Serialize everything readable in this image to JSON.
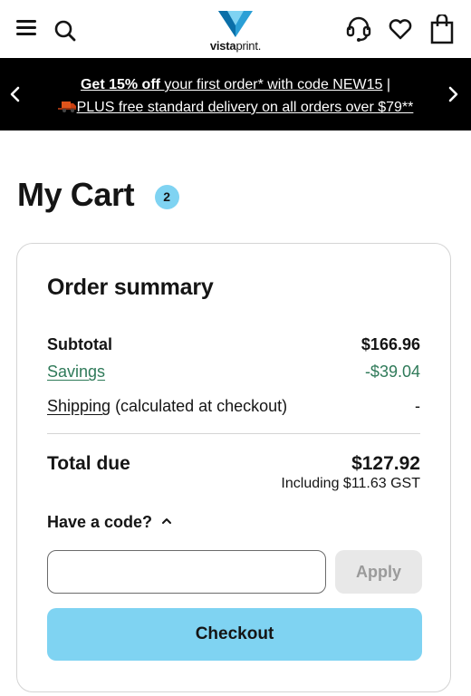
{
  "header": {
    "logo_brand_bold": "vista",
    "logo_brand_light": "print",
    "logo_dot": ".",
    "icons": {
      "menu": "hamburger-menu-icon",
      "search": "search-icon",
      "support": "headset-icon",
      "favorites": "heart-icon",
      "cart": "shopping-bag-icon"
    },
    "colors": {
      "logo_primary": "#2a9fd6",
      "logo_secondary": "#0a6fa8"
    }
  },
  "promo": {
    "line1_bold": "Get 15% off",
    "line1_rest": " your first order* with code NEW15",
    "line1_sep": " |",
    "line2": "PLUS free standard delivery on all orders over $79**",
    "icons": {
      "prev": "chevron-left-icon",
      "next": "chevron-right-icon",
      "truck": "delivery-truck-icon"
    },
    "background": "#000000"
  },
  "page": {
    "title": "My Cart",
    "item_count": "2"
  },
  "summary": {
    "title": "Order summary",
    "subtotal_label": "Subtotal",
    "subtotal_value": "$166.96",
    "savings_label": "Savings",
    "savings_value": "-$39.04",
    "shipping_label": "Shipping",
    "shipping_note": " (calculated at checkout)",
    "shipping_value": "-",
    "total_label": "Total due",
    "total_value": "$127.92",
    "gst_note": "Including $11.63 GST",
    "code_toggle_label": "Have a code?",
    "code_input_value": "",
    "code_input_placeholder": "",
    "apply_label": "Apply",
    "checkout_label": "Checkout",
    "colors": {
      "accent": "#7fd3f2",
      "savings": "#2f7a59",
      "disabled": "#e8e8e8"
    }
  }
}
